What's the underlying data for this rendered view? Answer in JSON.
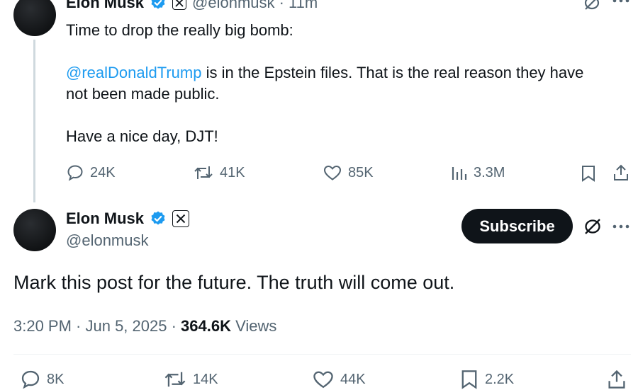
{
  "parent_tweet": {
    "author_name": "Elon Musk",
    "handle_time": "@elonmusk · 11m",
    "line1": "Time to drop the really big bomb:",
    "mention": "@realDonaldTrump",
    "line2_rest": " is in the Epstein files. That is the real reason they have",
    "line3": "not been made public.",
    "line4": "Have a nice day, DJT!",
    "stats": {
      "replies": "24K",
      "reposts": "41K",
      "likes": "85K",
      "views": "3.3M"
    }
  },
  "main_tweet": {
    "author_name": "Elon Musk",
    "handle": "@elonmusk",
    "subscribe_label": "Subscribe",
    "text": "Mark this post for the future. The truth will come out.",
    "timestamp": "3:20 PM · Jun 5, 2025 · ",
    "views_count": "364.6K",
    "views_label": " Views",
    "stats": {
      "replies": "8K",
      "reposts": "14K",
      "likes": "44K",
      "bookmarks": "2.2K"
    }
  },
  "colors": {
    "accent": "#1d9bf0",
    "text": "#0f1419",
    "muted": "#536471"
  }
}
